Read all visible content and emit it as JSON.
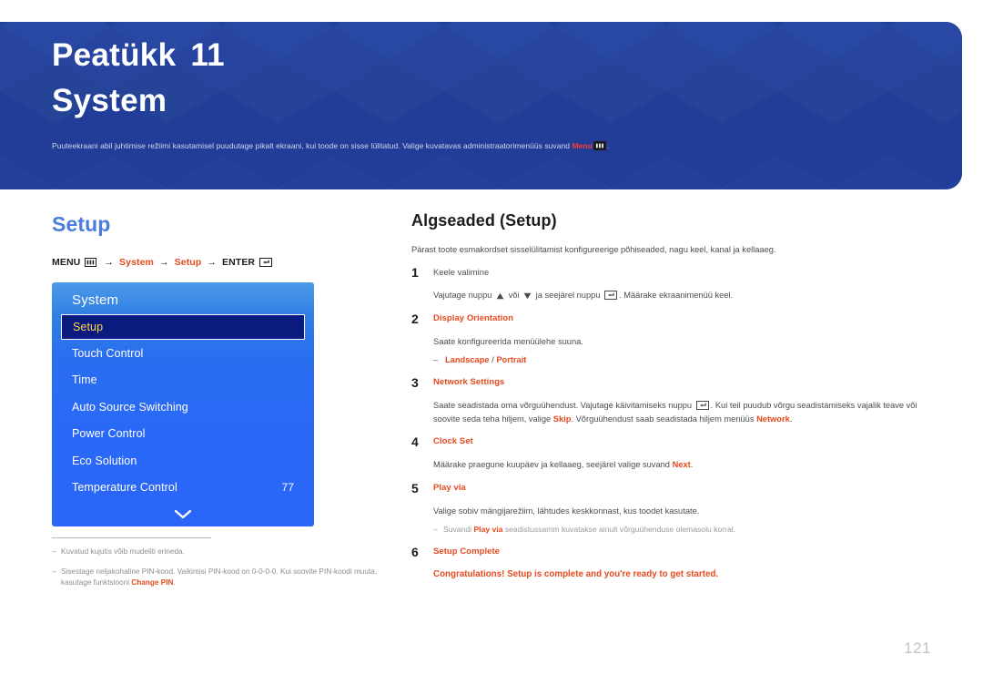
{
  "banner": {
    "chapter_label": "Peatükk",
    "chapter_number": "11",
    "title": "System",
    "subtitle_before": "Puuteekraani abil juhtimise režiimi kasutamisel puudutage pikalt ekraani, kui toode on sisse lülitatud. Valige kuvatavas administraatorimenüüs suvand ",
    "subtitle_keyword": "Menu",
    "subtitle_after": ".",
    "bg_color": "#23409a",
    "keyword_color": "#ff3b2f"
  },
  "left": {
    "section_title": "Setup",
    "path": {
      "menu_label": "MENU",
      "arrow": "→",
      "item1": "System",
      "item2": "Setup",
      "enter_label": "ENTER"
    },
    "osd": {
      "header": "System",
      "rows": [
        {
          "label": "Setup",
          "value": "",
          "selected": true
        },
        {
          "label": "Touch Control",
          "value": "",
          "selected": false
        },
        {
          "label": "Time",
          "value": "",
          "selected": false
        },
        {
          "label": "Auto Source Switching",
          "value": "",
          "selected": false
        },
        {
          "label": "Power Control",
          "value": "",
          "selected": false
        },
        {
          "label": "Eco Solution",
          "value": "",
          "selected": false
        },
        {
          "label": "Temperature Control",
          "value": "77",
          "selected": false
        }
      ],
      "scroll_icon": "chevron-down-icon",
      "bg_color": "#2a69f7",
      "selected_bg": "#0a1a7e",
      "selected_text_color": "#ffd54a"
    },
    "footnotes": [
      {
        "dash": "‒",
        "text": "Kuvatud kujutis võib mudeliti erineda.",
        "keyword": "",
        "text_after": ""
      },
      {
        "dash": "‒",
        "text": "Sisestage neljakohaline PIN-kood. Vaikimisi PIN-kood on 0-0-0-0. Kui soovite PIN-koodi muuta, kasutage funktsiooni ",
        "keyword": "Change PIN",
        "text_after": "."
      }
    ]
  },
  "right": {
    "title": "Algseaded (Setup)",
    "intro": "Pärast toote esmakordset sisselülitamist konfigureerige põhiseaded, nagu keel, kanal ja kellaaeg.",
    "steps": [
      {
        "num": "1",
        "head": "Keele valimine",
        "head_plain": true,
        "body_before": "Vajutage nuppu ",
        "body_mid": " või ",
        "body_mid2": " ja seejärel nuppu ",
        "body_after": ". Määrake ekraanimenüü keel."
      },
      {
        "num": "2",
        "head": "Display Orientation",
        "head_plain": false,
        "body": "Saate konfigureerida menüülehe suuna.",
        "option_dash": "‒",
        "option_a": "Landscape",
        "option_sep": " / ",
        "option_b": "Portrait"
      },
      {
        "num": "3",
        "head": "Network Settings",
        "head_plain": false,
        "body_1": "Saate seadistada oma võrguühendust. Vajutage käivitamiseks nuppu ",
        "body_2": ". Kui teil puudub võrgu seadistamiseks vajalik teave või soovite seda teha hiljem, valige ",
        "kw_1": "Skip",
        "body_3": ". Võrguühendust saab seadistada hiljem menüüs ",
        "kw_2": "Network",
        "body_4": "."
      },
      {
        "num": "4",
        "head": "Clock Set",
        "head_plain": false,
        "body_1": "Määrake praegune kuupäev ja kellaaeg, seejärel valige suvand ",
        "kw_1": "Next",
        "body_2": "."
      },
      {
        "num": "5",
        "head": "Play via",
        "head_plain": false,
        "body": "Valige sobiv mängijarežiim, lähtudes keskkonnast, kus toodet kasutate.",
        "note_dash": "‒",
        "note_1": "Suvandi ",
        "note_kw": "Play via",
        "note_2": " seadistussamm kuvatakse ainult võrguühenduse olemasolu korral."
      },
      {
        "num": "6",
        "head": "Setup Complete",
        "head_plain": false,
        "body": "Congratulations! Setup is complete and you're ready to get started."
      }
    ]
  },
  "page_number": "121"
}
